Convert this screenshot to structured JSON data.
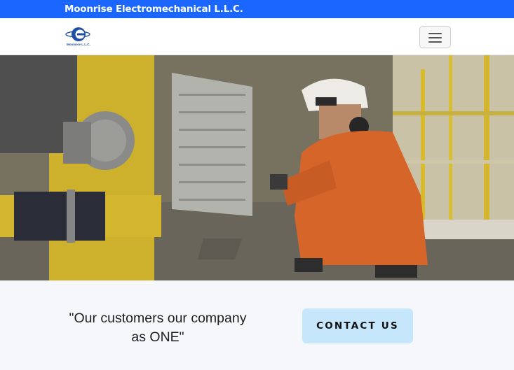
{
  "topbar": {
    "title": "Moonrise Electromechanical L.L.C."
  },
  "navbar": {
    "logo_icon": "moonrise-logo-icon",
    "logo_text": "Moonrise L.L.C.",
    "toggle_icon": "hamburger-menu-icon"
  },
  "hero": {
    "image_icon": "industrial-technician-photo"
  },
  "cta": {
    "tagline": "\"Our customers our company\nas ONE\"",
    "button_label": "CONTACT US"
  },
  "colors": {
    "topbar_bg": "#1a66ff",
    "button_bg": "#c6e7fb",
    "page_bg": "#f5f7fa"
  }
}
